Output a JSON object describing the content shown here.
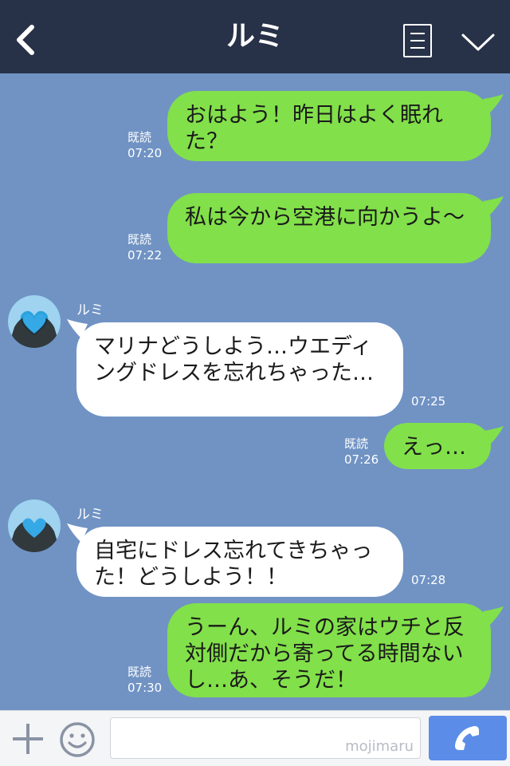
{
  "header": {
    "back_icon": "chevron-left-icon",
    "title": "ルミ",
    "menu_icon": "menu-list-icon",
    "collapse_icon": "chevron-down-icon"
  },
  "messages": [
    {
      "from": "me",
      "text": "おはよう！昨日はよく眠れた？",
      "read": "既読",
      "time": "07:20"
    },
    {
      "from": "me",
      "text": "私は今から空港に向かうよ〜",
      "read": "既読",
      "time": "07:22"
    },
    {
      "from": "them",
      "name": "ルミ",
      "text": "マリナどうしよう…ウエディングドレスを忘れちゃった…",
      "time": "07:25"
    },
    {
      "from": "me",
      "text": "えっ…",
      "read": "既読",
      "time": "07:26"
    },
    {
      "from": "them",
      "name": "ルミ",
      "text": "自宅にドレス忘れてきちゃった！どうしよう！！",
      "time": "07:28"
    },
    {
      "from": "me",
      "text": "うーん、ルミの家はウチと反対側だから寄ってる時間ないし…あ、そうだ！",
      "read": "既読",
      "time": "07:30"
    }
  ],
  "footer": {
    "plus_icon": "plus-icon",
    "emoji_icon": "smiley-icon",
    "input_value": "",
    "watermark": "mojimaru",
    "call_icon": "phone-icon"
  },
  "colors": {
    "header_bg": "#273147",
    "chat_bg": "#7093c4",
    "my_bubble": "#82e04a",
    "their_bubble": "#ffffff",
    "call_button": "#5b8de8"
  }
}
